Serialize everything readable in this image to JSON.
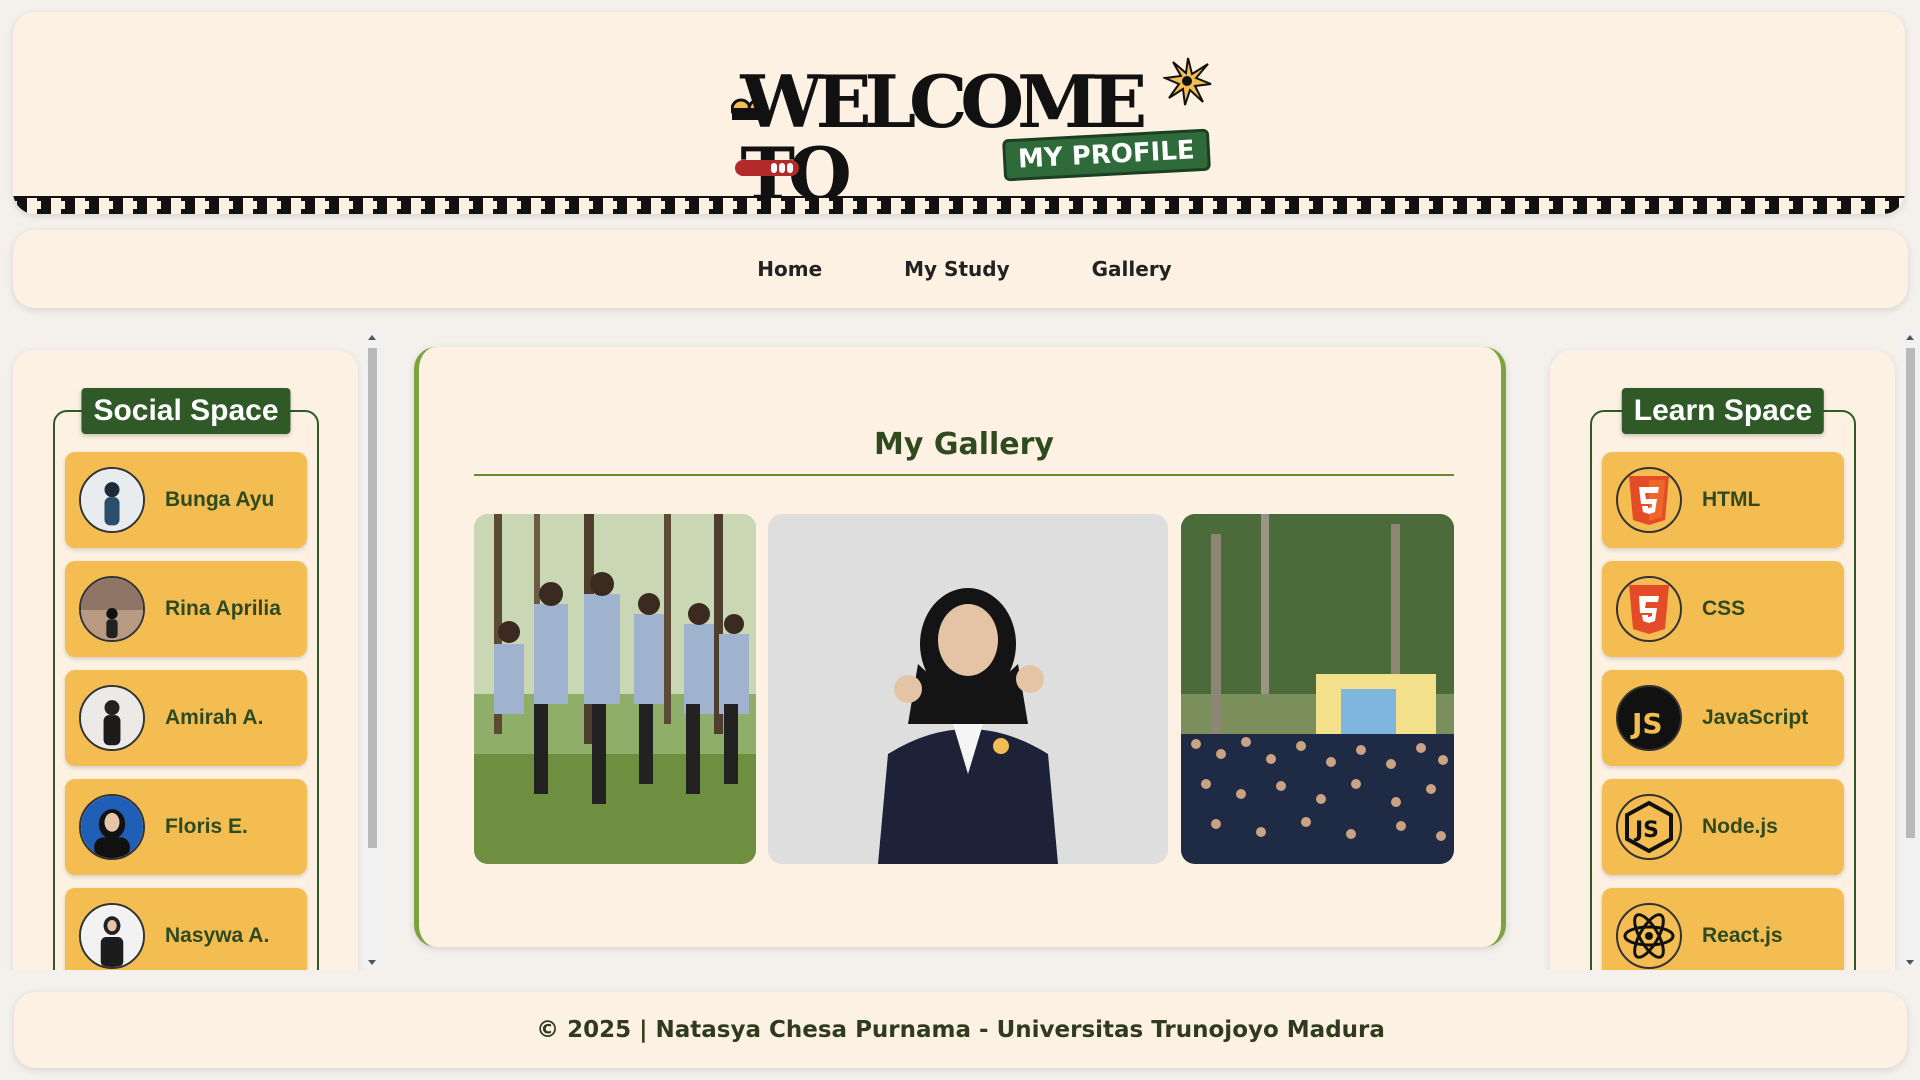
{
  "header": {
    "title": "WELCOME TO",
    "badge": "MY PROFILE"
  },
  "nav": {
    "items": [
      {
        "label": "Home"
      },
      {
        "label": "My Study"
      },
      {
        "label": "Gallery"
      }
    ]
  },
  "social": {
    "legend": "Social Space",
    "items": [
      {
        "label": "Bunga Ayu"
      },
      {
        "label": "Rina Aprilia"
      },
      {
        "label": "Amirah A."
      },
      {
        "label": "Floris E."
      },
      {
        "label": "Nasywa A."
      }
    ]
  },
  "main": {
    "title": "My Gallery"
  },
  "learn": {
    "legend": "Learn Space",
    "items": [
      {
        "label": "HTML",
        "icon": "html5-icon"
      },
      {
        "label": "CSS",
        "icon": "css3-icon"
      },
      {
        "label": "JavaScript",
        "icon": "javascript-icon"
      },
      {
        "label": "Node.js",
        "icon": "nodejs-icon"
      },
      {
        "label": "React.js",
        "icon": "react-icon"
      }
    ]
  },
  "footer": {
    "text": "© 2025 | Natasya Chesa Purnama - Universitas Trunojoyo Madura"
  },
  "colors": {
    "card_bg": "#fdf1e3",
    "accent_green": "#2f5a27",
    "item_yellow": "#f4bd52",
    "main_border": "#7ba33e"
  }
}
